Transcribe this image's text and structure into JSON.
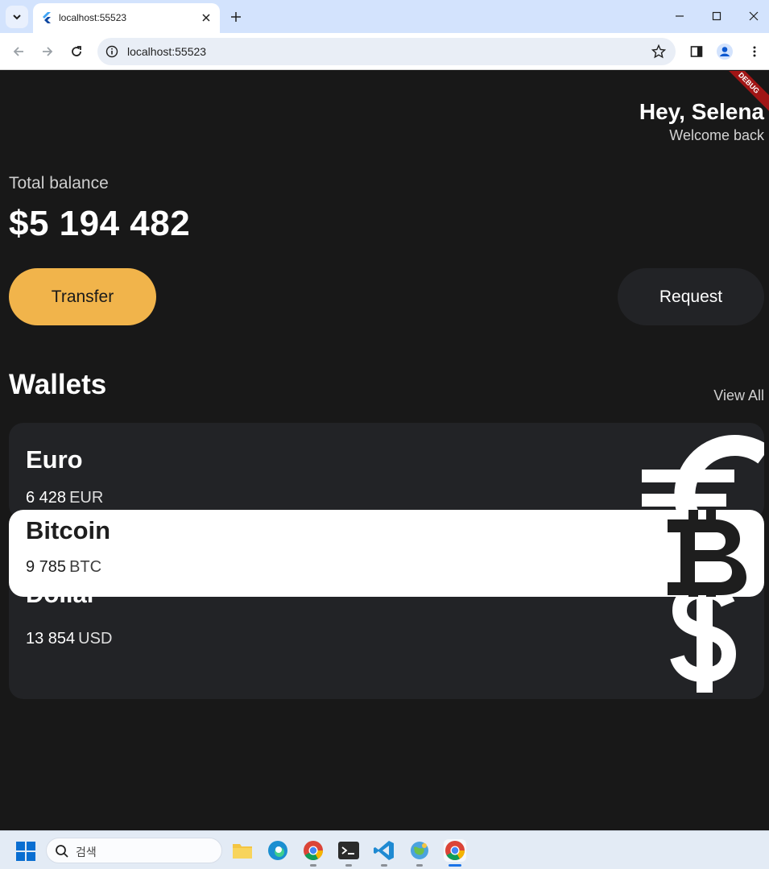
{
  "browser": {
    "tab_title": "localhost:55523",
    "url": "localhost:55523"
  },
  "app": {
    "debug_banner": "DEBUG",
    "greeting": {
      "name": "Hey, Selena",
      "subtitle": "Welcome back"
    },
    "balance": {
      "label": "Total balance",
      "value": "$5 194 482"
    },
    "actions": {
      "transfer_label": "Transfer",
      "request_label": "Request"
    },
    "wallets": {
      "title": "Wallets",
      "view_all": "View All",
      "items": [
        {
          "name": "Euro",
          "amount": "6 428",
          "code": "EUR",
          "icon": "euro-icon"
        },
        {
          "name": "Bitcoin",
          "amount": "9 785",
          "code": "BTC",
          "icon": "bitcoin-icon"
        },
        {
          "name": "Dollar",
          "amount": "13 854",
          "code": "USD",
          "icon": "dollar-icon"
        }
      ]
    },
    "colors": {
      "background": "#181818",
      "card_dark": "#222326",
      "card_light": "#ffffff",
      "accent": "#f1b44b"
    }
  },
  "taskbar": {
    "search_placeholder": "검색"
  }
}
